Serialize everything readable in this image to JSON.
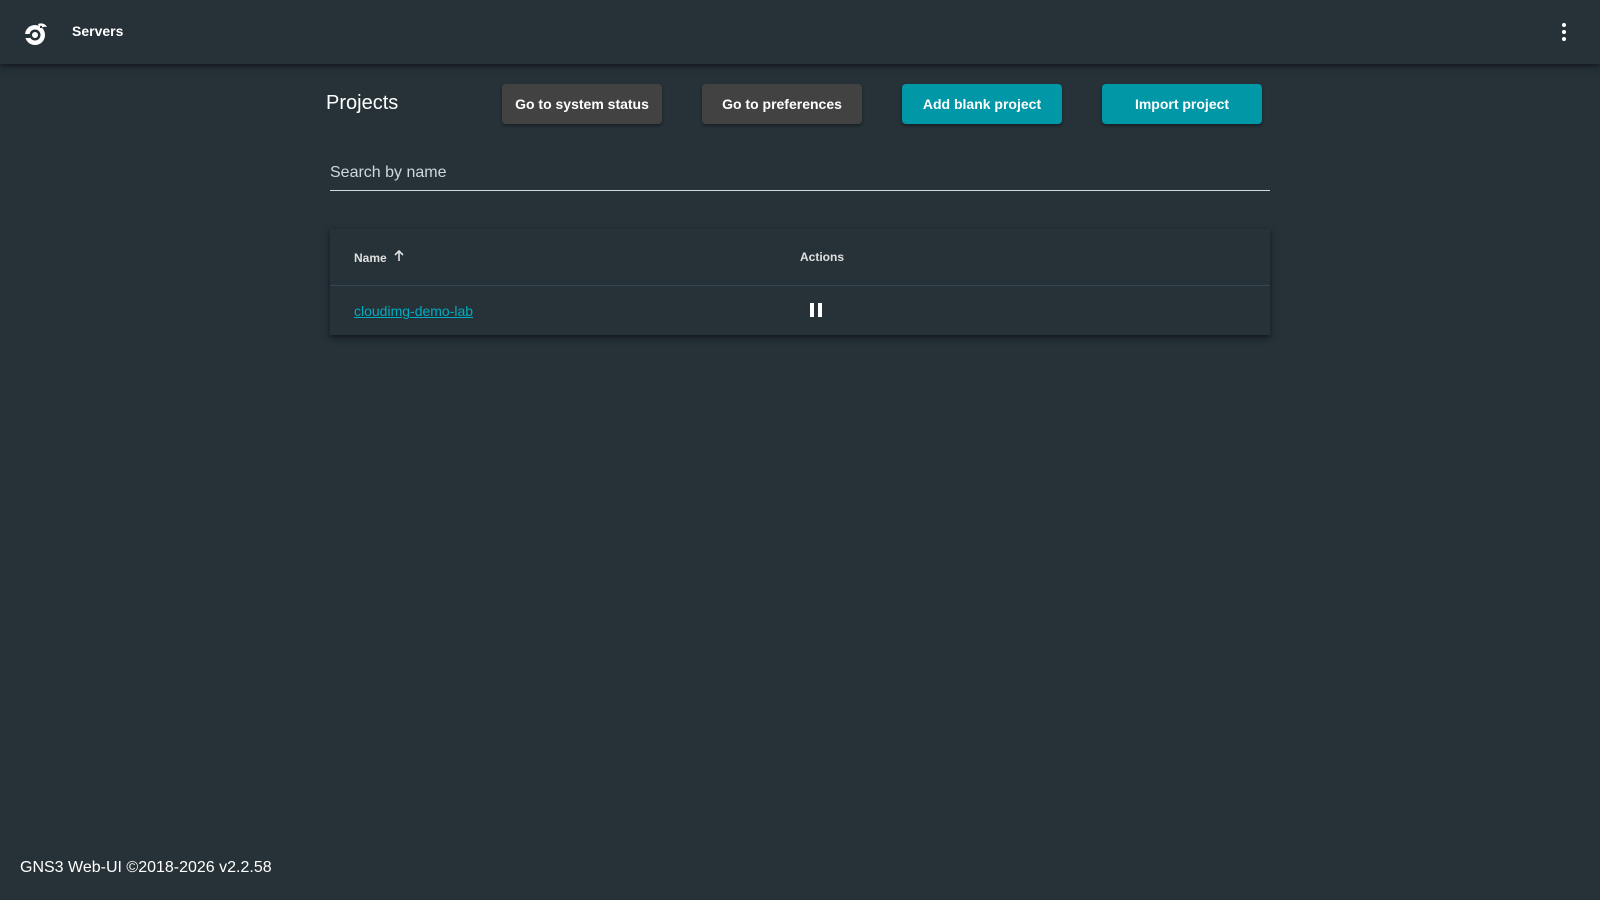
{
  "toolbar": {
    "title": "Servers",
    "logo_icon": "gns3-chameleon-logo-icon",
    "menu_icon": "more-vert-icon"
  },
  "main": {
    "page_title": "Projects",
    "buttons": {
      "system_status": "Go to system status",
      "preferences": "Go to preferences",
      "add_blank": "Add blank project",
      "import": "Import project"
    },
    "search": {
      "placeholder": "Search by name",
      "value": ""
    },
    "table": {
      "columns": {
        "name": "Name",
        "actions": "Actions"
      },
      "sort": {
        "column": "Name",
        "direction": "ascending",
        "icon": "arrow-up-icon"
      },
      "rows": [
        {
          "name": "cloudimg-demo-lab",
          "action_icon": "pause-icon"
        }
      ]
    }
  },
  "footer": {
    "text": "GNS3 Web-UI ©2018-2026 v2.2.58"
  },
  "colors": {
    "background": "#263238",
    "accent": "#0097a7",
    "link": "#00acc1",
    "dark_button": "#424242"
  }
}
